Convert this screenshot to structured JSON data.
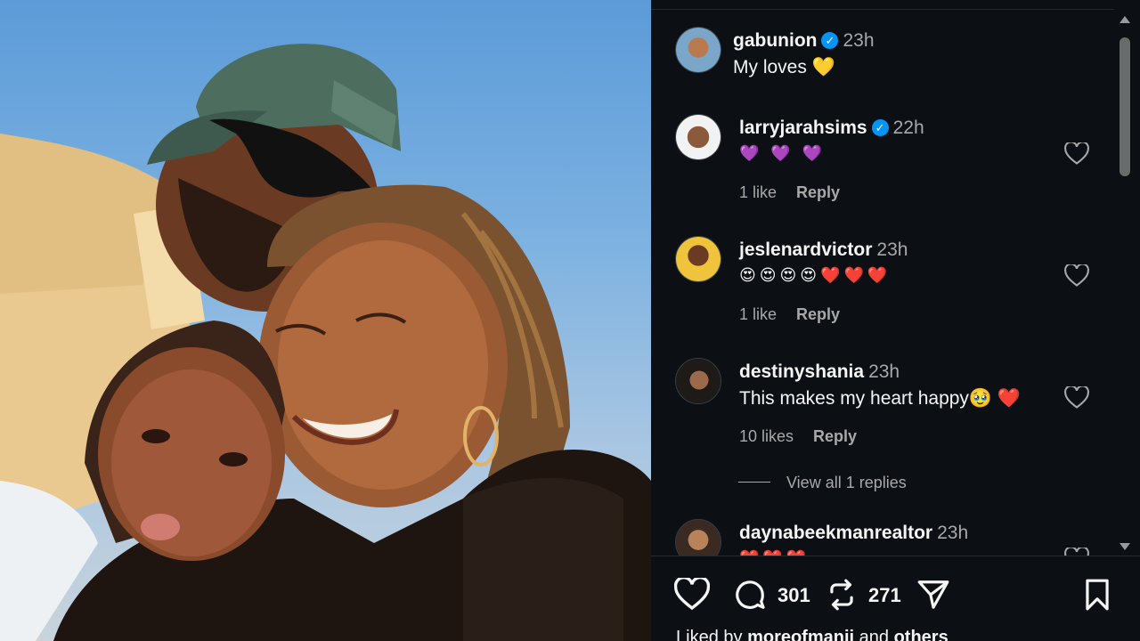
{
  "post": {
    "author": "gabunion",
    "time": "23h",
    "caption": "My loves 💛",
    "image_alt": "Selfie of a family smiling against a blue sky"
  },
  "comments": [
    {
      "username": "larryjarahsims",
      "verified": true,
      "time": "22h",
      "text": "💜 💜 💜",
      "likes": "1 like",
      "reply": "Reply"
    },
    {
      "username": "jeslenardvictor",
      "verified": false,
      "time": "23h",
      "text": "😍😍😍😍❤️❤️❤️",
      "likes": "1 like",
      "reply": "Reply"
    },
    {
      "username": "destinyshania",
      "verified": false,
      "time": "23h",
      "text": "This makes my heart happy🥹 ❤️",
      "likes": "10 likes",
      "reply": "Reply"
    },
    {
      "username": "daynabeekmanrealtor",
      "verified": false,
      "time": "23h",
      "text": "❤️❤️❤️",
      "likes": "",
      "reply": ""
    }
  ],
  "view_replies": "View all 1 replies",
  "actions": {
    "comment_count": "301",
    "repost_count": "271"
  },
  "liked_by": {
    "prefix": "Liked by ",
    "user": "moreofmanii",
    "middle": " and ",
    "others": "others"
  },
  "colors": {
    "panel_bg": "#0c1014",
    "verified_blue": "#0095f6",
    "secondary_text": "#a8a8a8"
  }
}
